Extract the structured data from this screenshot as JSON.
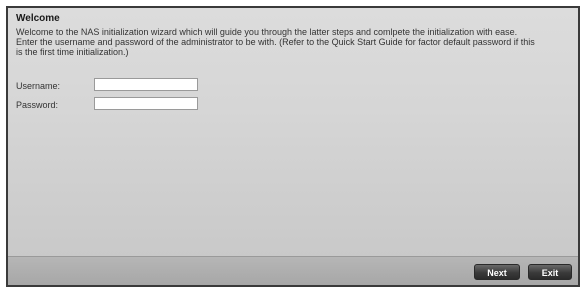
{
  "dialog": {
    "title": "Welcome",
    "description": "Welcome to the NAS initialization wizard which will guide you through the latter steps and comlpete the initialization with ease. Enter the username and password of the administrator to be with. (Refer to the Quick Start Guide for factor default password if this is the first time initialization.)"
  },
  "form": {
    "username": {
      "label": "Username:",
      "value": ""
    },
    "password": {
      "label": "Password:",
      "value": ""
    }
  },
  "buttons": {
    "next": "Next",
    "exit": "Exit"
  }
}
